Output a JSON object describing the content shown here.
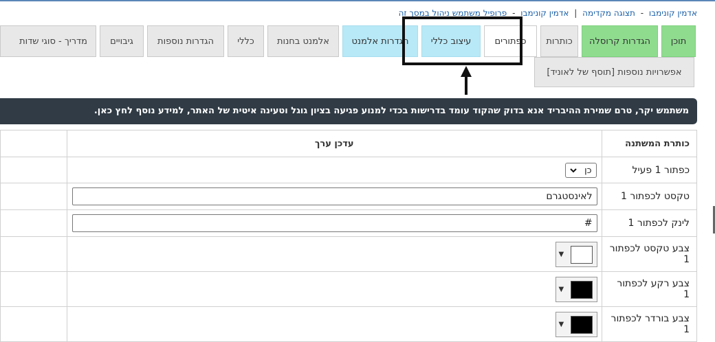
{
  "breadcrumb": {
    "items": [
      "אדמין קונימבו",
      "תצוגה מקדימה",
      "אדמין קונימבו",
      "פרופיל משתמש ניהול במסך זה"
    ]
  },
  "tabs": [
    {
      "label": "תוכן",
      "style": "green"
    },
    {
      "label": "הגדרות קרוסלה",
      "style": "green"
    },
    {
      "label": "כותרות",
      "style": "plain"
    },
    {
      "label": "כפתורים",
      "style": "active"
    },
    {
      "label": "עיצוב כללי",
      "style": "cyan"
    },
    {
      "label": "הגדרות אלמנט",
      "style": "cyan"
    },
    {
      "label": "אלמנט בחנות",
      "style": "plain"
    },
    {
      "label": "כללי",
      "style": "plain"
    },
    {
      "label": "הגדרות נוספות",
      "style": "plain"
    },
    {
      "label": "גיבויים",
      "style": "plain"
    },
    {
      "label": "מדריך - סוגי שדות",
      "style": "plain"
    }
  ],
  "tab_row2": {
    "label": "אפשרויות נוספות [תוסף של לאוניד]"
  },
  "notice": {
    "text": "משתמש יקר, טרם שמירת ההיבריד אנא בדוק שהקוד עומד בדרישות בכדי למנוע פגיעה בציון גוגל וטעינה איטית של האתר, למידע נוסף ",
    "link": "לחץ כאן."
  },
  "table": {
    "col_name": "כותרת המשתנה",
    "col_value": "עדכן ערך",
    "rows": [
      {
        "name": "כפתור 1 פעיל",
        "kind": "select",
        "value": "כן"
      },
      {
        "name": "טקסט לכפתור 1",
        "kind": "text",
        "value": "לאינסטגרם"
      },
      {
        "name": "לינק לכפתור 1",
        "kind": "text",
        "value": "#"
      },
      {
        "name": "צבע טקסט לכפתור 1",
        "kind": "color",
        "color": "#ffffff"
      },
      {
        "name": "צבע רקע לכפתור 1",
        "kind": "color",
        "color": "#000000"
      },
      {
        "name": "צבע בורדר לכפתור 1",
        "kind": "color",
        "color": "#000000"
      }
    ]
  },
  "colors": {
    "green_tab": "#8fdc8f",
    "cyan_tab": "#b8e9f7",
    "notice_bg": "#303b45",
    "link": "#1a5fa8"
  }
}
